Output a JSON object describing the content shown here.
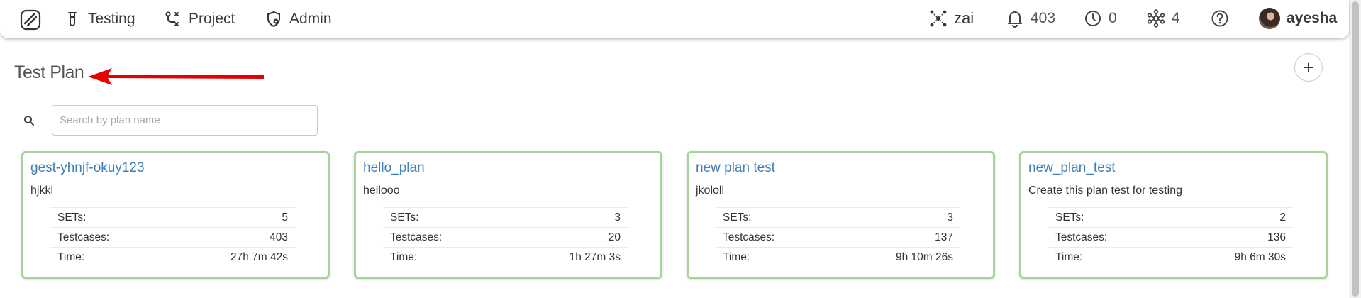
{
  "nav": {
    "items": [
      {
        "label": "Testing",
        "icon": "test-tube-icon"
      },
      {
        "label": "Project",
        "icon": "workflow-icon"
      },
      {
        "label": "Admin",
        "icon": "shield-gear-icon"
      }
    ],
    "right": {
      "workspace": "zai",
      "notifications": "403",
      "timers": "0",
      "nodes": "4",
      "user": "ayesha"
    }
  },
  "page": {
    "title": "Test Plan",
    "add_label": "+",
    "search_placeholder": "Search by plan name"
  },
  "cards": [
    {
      "title": "gest-yhnjf-okuy123",
      "description": "hjkkl",
      "sets_label": "SETs:",
      "sets": "5",
      "testcases_label": "Testcases:",
      "testcases": "403",
      "time_label": "Time:",
      "time": "27h 7m 42s"
    },
    {
      "title": "hello_plan",
      "description": "hellooo",
      "sets_label": "SETs:",
      "sets": "3",
      "testcases_label": "Testcases:",
      "testcases": "20",
      "time_label": "Time:",
      "time": "1h 27m 3s"
    },
    {
      "title": "new plan test",
      "description": "jkololl",
      "sets_label": "SETs:",
      "sets": "3",
      "testcases_label": "Testcases:",
      "testcases": "137",
      "time_label": "Time:",
      "time": "9h 10m 26s"
    },
    {
      "title": "new_plan_test",
      "description": "Create this plan test for testing",
      "sets_label": "SETs:",
      "sets": "2",
      "testcases_label": "Testcases:",
      "testcases": "136",
      "time_label": "Time:",
      "time": "9h 6m 30s"
    }
  ],
  "colors": {
    "card_border": "#a5d49a",
    "card_title": "#3f7fb6",
    "annotation_arrow": "#e60000"
  }
}
